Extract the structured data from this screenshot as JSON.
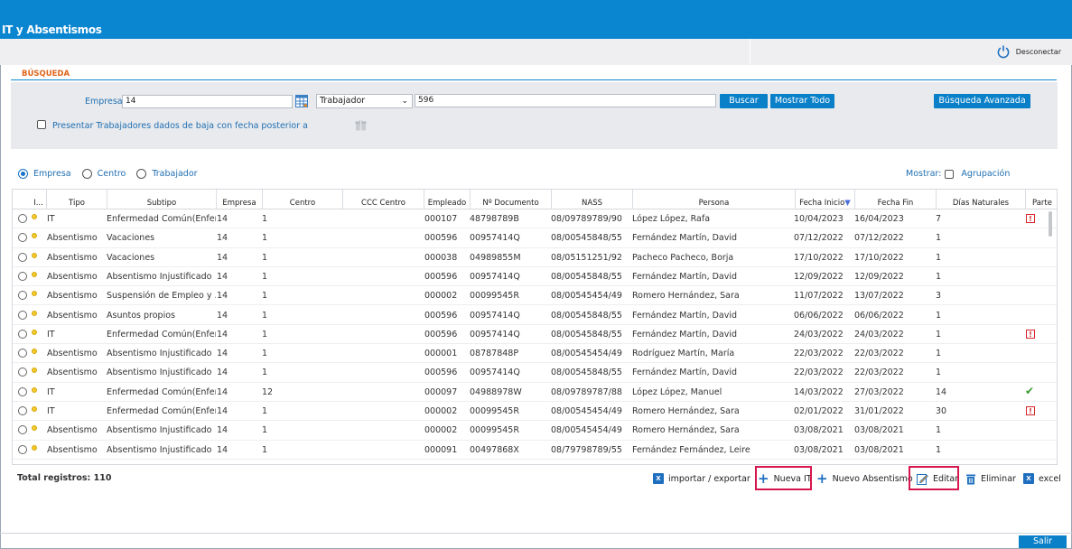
{
  "app": {
    "title": "IT y Absentismos",
    "logout_label": "Desconectar",
    "exit_label": "Salir"
  },
  "search": {
    "section_label": "BÚSQUEDA",
    "empresa_label": "Empresa",
    "empresa_value": "14",
    "selector_value": "Trabajador",
    "worker_value": "596",
    "buscar_label": "Buscar",
    "mostrar_todo_label": "Mostrar Todo",
    "advanced_label": "Búsqueda Avanzada",
    "presentar_label": "Presentar Trabajadores dados de baja con fecha posterior a"
  },
  "grouping": {
    "options": [
      "Empresa",
      "Centro",
      "Trabajador"
    ],
    "selected": "Empresa",
    "mostrar_label": "Mostrar:",
    "agrupacion_label": "Agrupación"
  },
  "table": {
    "columns": [
      "I...",
      "Tipo",
      "Subtipo",
      "Empresa",
      "Centro",
      "CCC Centro",
      "Empleado",
      "Nº Documento",
      "NASS",
      "Persona",
      "Fecha Inicio",
      "Fecha Fin",
      "Días Naturales",
      "Parte"
    ],
    "sort_indicator": "▼",
    "rows": [
      {
        "tipo": "IT",
        "subtipo": "Enfermedad Común(Enfer...",
        "empresa": "14",
        "centro": "1",
        "empleado": "000107",
        "doc": "48798789B",
        "nass": "08/09789789/90",
        "persona": "López López, Rafa",
        "inicio": "10/04/2023",
        "fin": "16/04/2023",
        "dias": "7",
        "parte": "alert"
      },
      {
        "tipo": "Absentismo",
        "subtipo": "Vacaciones",
        "empresa": "14",
        "centro": "1",
        "empleado": "000596",
        "doc": "00957414Q",
        "nass": "08/00545848/55",
        "persona": "Fernández Martín, David",
        "inicio": "07/12/2022",
        "fin": "07/12/2022",
        "dias": "1",
        "parte": ""
      },
      {
        "tipo": "Absentismo",
        "subtipo": "Vacaciones",
        "empresa": "14",
        "centro": "1",
        "empleado": "000038",
        "doc": "04989855M",
        "nass": "08/05151251/92",
        "persona": "Pacheco Pacheco, Borja",
        "inicio": "17/10/2022",
        "fin": "17/10/2022",
        "dias": "1",
        "parte": ""
      },
      {
        "tipo": "Absentismo",
        "subtipo": "Absentismo Injustificado",
        "empresa": "14",
        "centro": "1",
        "empleado": "000596",
        "doc": "00957414Q",
        "nass": "08/00545848/55",
        "persona": "Fernández Martín, David",
        "inicio": "12/09/2022",
        "fin": "12/09/2022",
        "dias": "1",
        "parte": ""
      },
      {
        "tipo": "Absentismo",
        "subtipo": "Suspensión de Empleo y ...",
        "empresa": "14",
        "centro": "1",
        "empleado": "000002",
        "doc": "00099545R",
        "nass": "08/00545454/49",
        "persona": "Romero Hernández, Sara",
        "inicio": "11/07/2022",
        "fin": "13/07/2022",
        "dias": "3",
        "parte": ""
      },
      {
        "tipo": "Absentismo",
        "subtipo": "Asuntos propios",
        "empresa": "14",
        "centro": "1",
        "empleado": "000596",
        "doc": "00957414Q",
        "nass": "08/00545848/55",
        "persona": "Fernández Martín, David",
        "inicio": "06/06/2022",
        "fin": "06/06/2022",
        "dias": "1",
        "parte": ""
      },
      {
        "tipo": "IT",
        "subtipo": "Enfermedad Común(Enfer...",
        "empresa": "14",
        "centro": "1",
        "empleado": "000596",
        "doc": "00957414Q",
        "nass": "08/00545848/55",
        "persona": "Fernández Martín, David",
        "inicio": "24/03/2022",
        "fin": "24/03/2022",
        "dias": "1",
        "parte": "alert"
      },
      {
        "tipo": "Absentismo",
        "subtipo": "Absentismo Injustificado",
        "empresa": "14",
        "centro": "1",
        "empleado": "000001",
        "doc": "08787848P",
        "nass": "08/00545454/49",
        "persona": "Rodríguez Martín, María",
        "inicio": "22/03/2022",
        "fin": "22/03/2022",
        "dias": "1",
        "parte": ""
      },
      {
        "tipo": "Absentismo",
        "subtipo": "Absentismo Injustificado",
        "empresa": "14",
        "centro": "1",
        "empleado": "000596",
        "doc": "00957414Q",
        "nass": "08/00545848/55",
        "persona": "Fernández Martín, David",
        "inicio": "22/03/2022",
        "fin": "22/03/2022",
        "dias": "1",
        "parte": ""
      },
      {
        "tipo": "IT",
        "subtipo": "Enfermedad Común(Enfer...",
        "empresa": "14",
        "centro": "12",
        "empleado": "000097",
        "doc": "04988978W",
        "nass": "08/09789787/88",
        "persona": "López López, Manuel",
        "inicio": "14/03/2022",
        "fin": "27/03/2022",
        "dias": "14",
        "parte": "check"
      },
      {
        "tipo": "IT",
        "subtipo": "Enfermedad Común(Enfer...",
        "empresa": "14",
        "centro": "1",
        "empleado": "000002",
        "doc": "00099545R",
        "nass": "08/00545454/49",
        "persona": "Romero Hernández, Sara",
        "inicio": "02/01/2022",
        "fin": "31/01/2022",
        "dias": "30",
        "parte": "alert"
      },
      {
        "tipo": "Absentismo",
        "subtipo": "Absentismo Injustificado",
        "empresa": "14",
        "centro": "1",
        "empleado": "000002",
        "doc": "00099545R",
        "nass": "08/00545454/49",
        "persona": "Romero Hernández, Sara",
        "inicio": "03/08/2021",
        "fin": "03/08/2021",
        "dias": "1",
        "parte": ""
      },
      {
        "tipo": "Absentismo",
        "subtipo": "Absentismo Injustificado",
        "empresa": "14",
        "centro": "1",
        "empleado": "000091",
        "doc": "00497868X",
        "nass": "08/79798789/55",
        "persona": "Fernández Fernández, Leire",
        "inicio": "03/08/2021",
        "fin": "03/08/2021",
        "dias": "1",
        "parte": ""
      }
    ]
  },
  "footer": {
    "total_label": "Total registros: 110",
    "import_label": "importar / exportar",
    "nueva_it_label": "Nueva IT",
    "nuevo_abs_label": "Nuevo Absentismo",
    "editar_label": "Editar",
    "eliminar_label": "Eliminar",
    "excel_label": "excel",
    "xls_glyph": "X",
    "highlight_color": "#d6174e"
  },
  "colors": {
    "brand": "#0a85d0",
    "accent_orange": "#e0651b",
    "link": "#1f6fb2"
  }
}
